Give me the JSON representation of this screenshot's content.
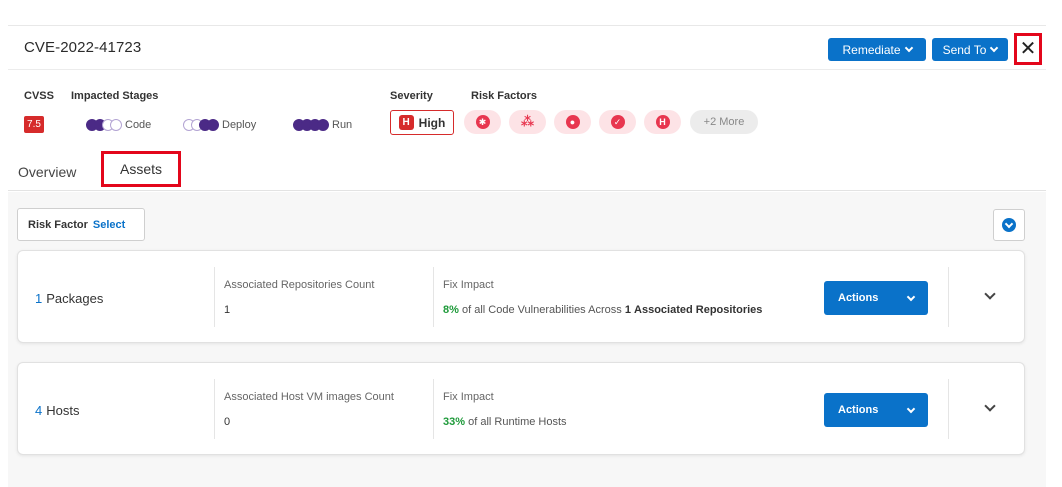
{
  "header": {
    "cve_id": "CVE-2022-41723",
    "remediate_label": "Remediate",
    "send_to_label": "Send To",
    "close_icon": "close-icon"
  },
  "summary": {
    "cvss_label": "CVSS",
    "cvss_score": "7.5",
    "impacted_stages_label": "Impacted Stages",
    "stages": [
      {
        "label": "Code"
      },
      {
        "label": "Deploy"
      },
      {
        "label": "Run"
      }
    ],
    "severity_label": "Severity",
    "severity_letter": "H",
    "severity_value": "High",
    "risk_factors_label": "Risk Factors",
    "risk_factor_icons": [
      "bug-icon",
      "network-icon",
      "bomb-icon",
      "check-icon",
      "h-icon"
    ],
    "risk_factor_h": "H",
    "risk_factors_more": "+2 More"
  },
  "tabs": [
    {
      "label": "Overview"
    },
    {
      "label": "Assets"
    }
  ],
  "filter": {
    "label": "Risk Factor",
    "select_label": "Select"
  },
  "cards": [
    {
      "count": "1",
      "name": "Packages",
      "assoc_label": "Associated Repositories Count",
      "assoc_value": "1",
      "fix_label": "Fix Impact",
      "fix_pct": "8%",
      "fix_text_1": "of all Code Vulnerabilities Across",
      "fix_num": "1",
      "fix_text_2": "Associated Repositories",
      "actions_label": "Actions"
    },
    {
      "count": "4",
      "name": "Hosts",
      "assoc_label": "Associated Host VM images Count",
      "assoc_value": "0",
      "fix_label": "Fix Impact",
      "fix_pct": "33%",
      "fix_text_1": "of all Runtime Hosts",
      "actions_label": "Actions"
    }
  ],
  "colors": {
    "primary": "#0a72c9",
    "critical": "#d62b2b",
    "highlight_box": "#e3061b",
    "success": "#1e9a3a",
    "stage_purple": "#4b2a86"
  }
}
